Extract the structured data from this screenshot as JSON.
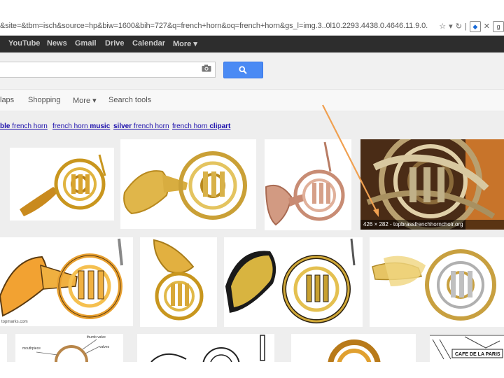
{
  "browser": {
    "url_text": "&site=&tbm=isch&source=hp&biw=1600&bih=727&q=french+horn&oq=french+horn&gs_l=img.3..0l10.2293.4438.0.4646.11.9.0."
  },
  "google_bar": {
    "items": [
      "YouTube",
      "News",
      "Gmail",
      "Drive",
      "Calendar",
      "More ▾"
    ]
  },
  "tabs": {
    "items": [
      "laps",
      "Shopping",
      "More ▾",
      "Search tools"
    ]
  },
  "related_searches": [
    {
      "bold": "ble",
      "rest": " french horn",
      "bold_first": true
    },
    {
      "rest": "french horn ",
      "bold": "music",
      "bold_first": false
    },
    {
      "bold": "silver",
      "rest": " french horn",
      "bold_first": true
    },
    {
      "rest": "french horn ",
      "bold": "clipart",
      "bold_first": false
    }
  ],
  "results": {
    "hover_caption": "426 × 282 - topbrassfrenchhornchoir.org",
    "diagram_labels": [
      "thumb valve",
      "valves",
      "mouthpiece"
    ],
    "small_site": "topmarks.com",
    "sign_text": "CAFE DE LA PARIS"
  },
  "colors": {
    "arrow": "#f0a050",
    "search_blue": "#4a8af4",
    "gbar": "#2d2d2d"
  }
}
